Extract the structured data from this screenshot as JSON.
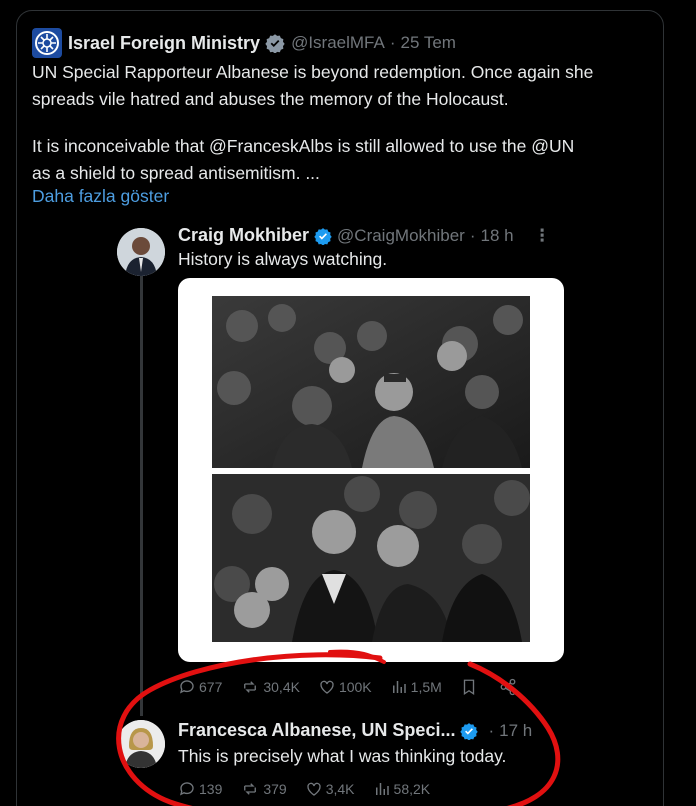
{
  "tweet": {
    "author_name": "Israel Foreign Ministry",
    "handle": "@IsraelMFA",
    "separator": "·",
    "time": "25 Tem",
    "text_line1": "UN Special Rapporteur Albanese is beyond redemption. Once again she",
    "text_line2": "spreads vile hatred and abuses the memory of the Holocaust.",
    "text_line3": "It is inconceivable that @FranceskAlbs is still allowed to use the @UN",
    "text_line4": "as a shield to spread antisemitism. ...",
    "show_more": "Daha fazla göster"
  },
  "quoted_1": {
    "author_name": "Craig Mokhiber",
    "handle": "@CraigMokhiber",
    "separator": "·",
    "time": "18 h",
    "text": "History is always watching.",
    "stats": {
      "replies": "677",
      "reposts": "30,4K",
      "likes": "100K",
      "views": "1,5M"
    }
  },
  "quoted_2": {
    "author_name": "Francesca Albanese, UN Speci...",
    "separator": "·",
    "time": "17 h",
    "text": "This is precisely what I was thinking today.",
    "stats": {
      "replies": "139",
      "reposts": "379",
      "likes": "3,4K",
      "views": "58,2K"
    }
  },
  "colors": {
    "background": "#000000",
    "text": "#e7e9ea",
    "muted": "#71767b",
    "link": "#4d9de0",
    "verified_gold": "#e8b73a",
    "verified_blue": "#1d9bf0",
    "annotation_red": "#e11010"
  },
  "icons": [
    "verified-icon",
    "more-icon",
    "reply-icon",
    "repost-icon",
    "like-icon",
    "views-icon",
    "bookmark-icon",
    "share-icon"
  ]
}
